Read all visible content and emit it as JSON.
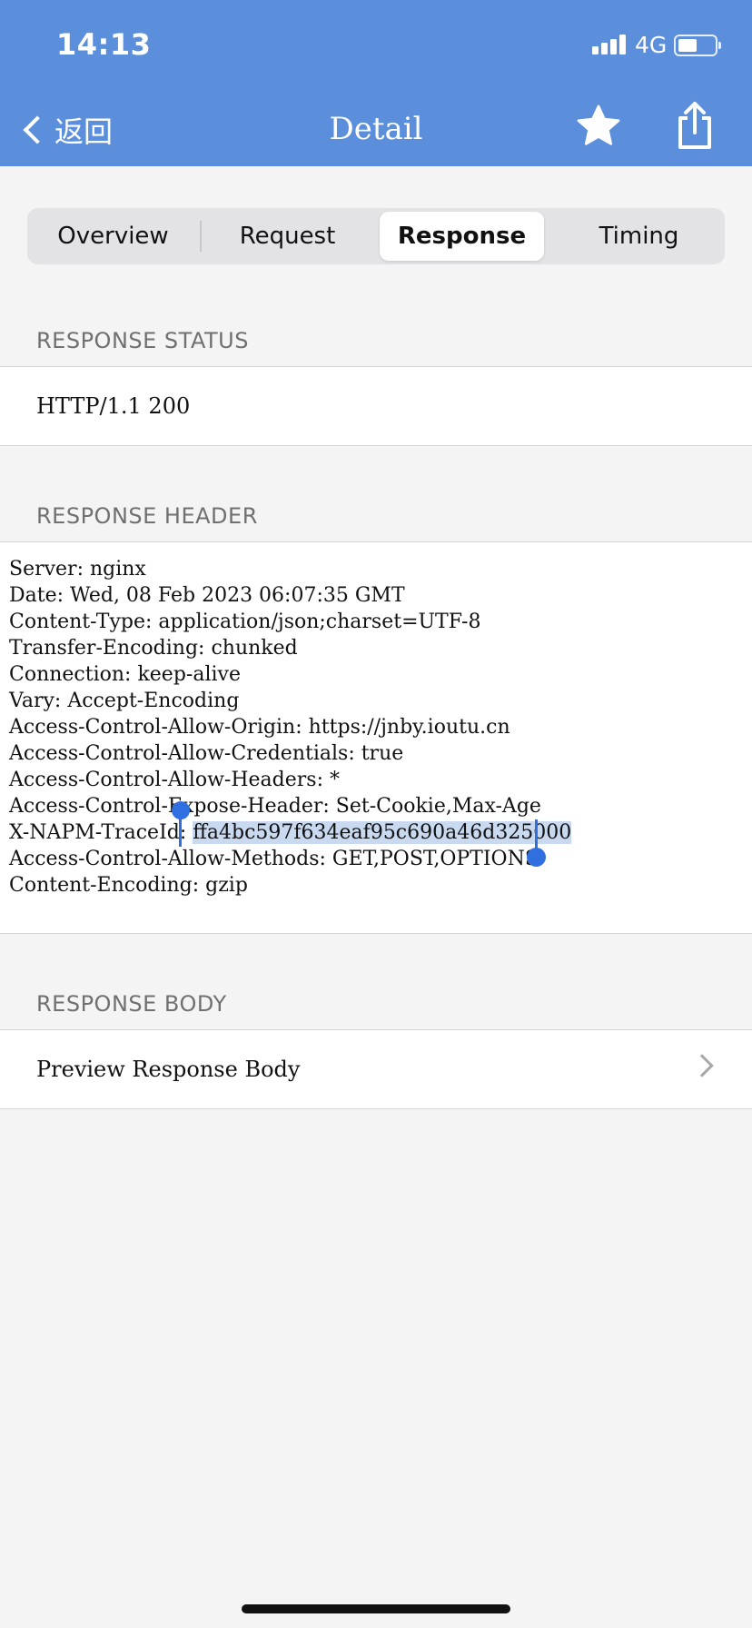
{
  "status_bar": {
    "time": "14:13",
    "network": "4G"
  },
  "nav": {
    "back_label": "返回",
    "title": "Detail",
    "accent_color": "#5b8fdc"
  },
  "tabs": [
    {
      "label": "Overview",
      "active": false
    },
    {
      "label": "Request",
      "active": false
    },
    {
      "label": "Response",
      "active": true
    },
    {
      "label": "Timing",
      "active": false
    }
  ],
  "response_status": {
    "heading": "RESPONSE STATUS",
    "value": "HTTP/1.1 200"
  },
  "response_header": {
    "heading": "RESPONSE HEADER",
    "lines": [
      "Server: nginx",
      "Date: Wed, 08 Feb 2023 06:07:35 GMT",
      "Content-Type: application/json;charset=UTF-8",
      "Transfer-Encoding: chunked",
      "Connection: keep-alive",
      "Vary: Accept-Encoding",
      "Access-Control-Allow-Origin: https://jnby.ioutu.cn",
      "Access-Control-Allow-Credentials: true",
      "Access-Control-Allow-Headers: *",
      "Access-Control-Expose-Header: Set-Cookie,Max-Age",
      "X-NAPM-TraceId: ffa4bc597f634eaf95c690a46d325000",
      "Access-Control-Allow-Methods: GET,POST,OPTIONS",
      "Content-Encoding: gzip"
    ],
    "trace_key": "X-NAPM-TraceId: ",
    "trace_value_selected": "ffa4bc597f634eaf95c690a46d325000"
  },
  "response_body": {
    "heading": "RESPONSE BODY",
    "preview_label": "Preview Response Body"
  },
  "icons": [
    "chevron-left-icon",
    "star-icon",
    "share-icon",
    "chevron-right-icon",
    "signal-icon",
    "battery-icon"
  ]
}
